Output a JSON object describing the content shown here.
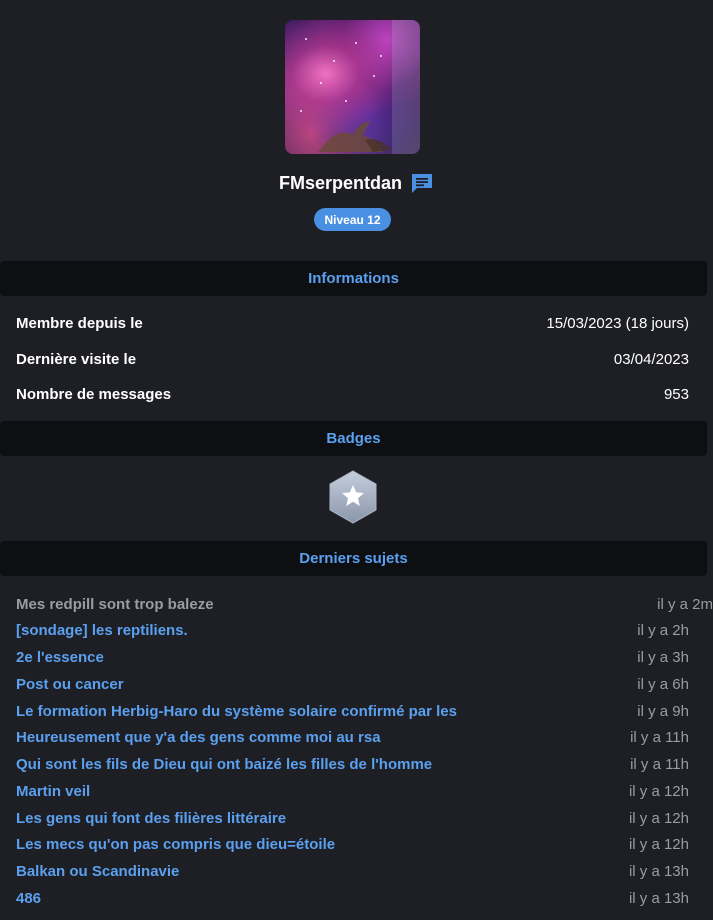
{
  "profile": {
    "username": "FMserpentdan",
    "level_label": "Niveau 12"
  },
  "sections": {
    "informations": "Informations",
    "badges": "Badges",
    "derniers_sujets": "Derniers sujets"
  },
  "info": [
    {
      "label": "Membre depuis le",
      "value": "15/03/2023 (18 jours)"
    },
    {
      "label": "Dernière visite le",
      "value": "03/04/2023"
    },
    {
      "label": "Nombre de messages",
      "value": "953"
    }
  ],
  "topics": [
    {
      "title": "Mes redpill sont trop baleze",
      "time": "il y a 2m",
      "visited": true
    },
    {
      "title": "[sondage] les reptiliens.",
      "time": "il y a 2h"
    },
    {
      "title": "2e l'essence",
      "time": "il y a 3h"
    },
    {
      "title": "Post ou cancer",
      "time": "il y a 6h"
    },
    {
      "title": "Le formation Herbig-Haro du système solaire confirmé par les",
      "time": "il y a 9h"
    },
    {
      "title": "Heureusement que y'a des gens comme moi au rsa",
      "time": "il y a 11h"
    },
    {
      "title": "Qui sont les fils de Dieu qui ont baizé les filles de l'homme",
      "time": "il y a 11h"
    },
    {
      "title": "Martin veil",
      "time": "il y a 12h"
    },
    {
      "title": "Les gens qui font des filières littéraire",
      "time": "il y a 12h"
    },
    {
      "title": "Les mecs qu'on pas compris que dieu=étoile",
      "time": "il y a 12h"
    },
    {
      "title": "Balkan ou Scandinavie",
      "time": "il y a 13h"
    },
    {
      "title": "486",
      "time": "il y a 13h"
    }
  ],
  "colors": {
    "background": "#1e1f25",
    "header_bg": "#0e0f13",
    "accent": "#5aa0ef",
    "level_badge": "#4a90e2",
    "muted": "#9a9ca3"
  },
  "icons": {
    "message": "message-icon",
    "badge": "star-badge-icon"
  }
}
